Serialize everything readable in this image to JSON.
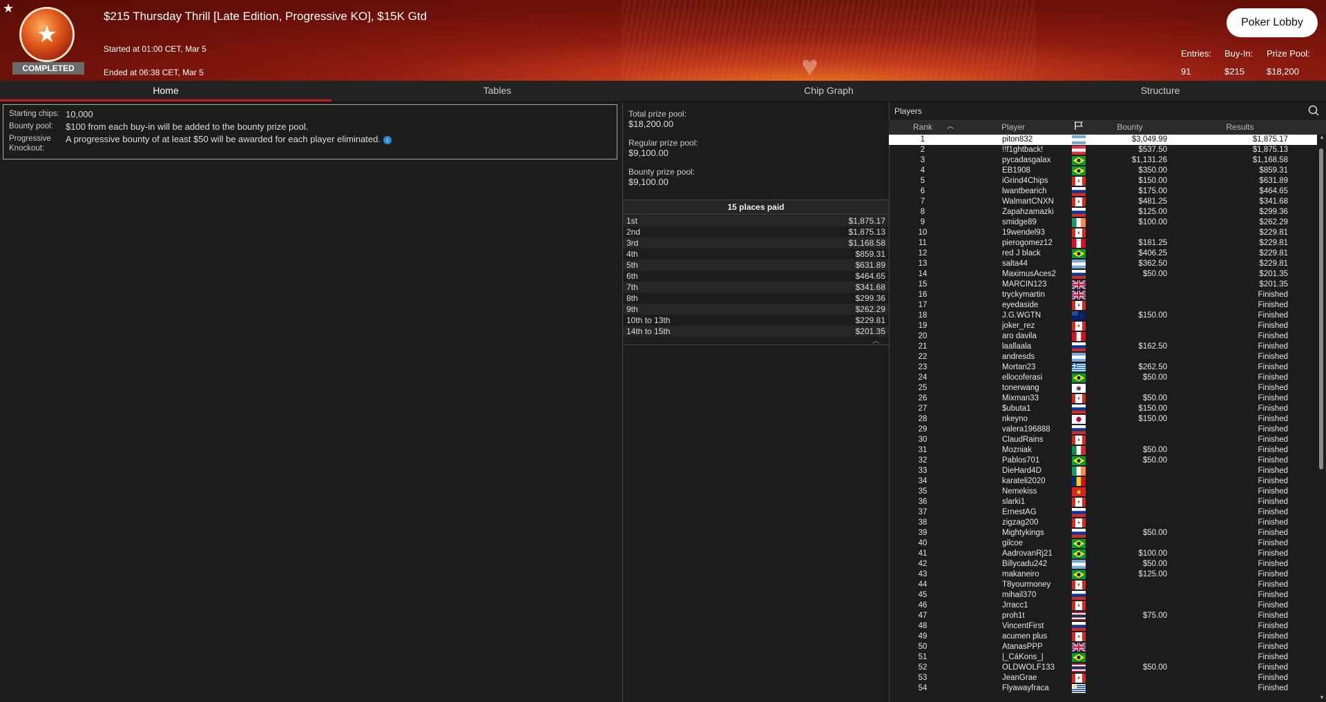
{
  "header": {
    "title": "$215 Thursday Thrill [Late Edition, Progressive KO], $15K Gtd",
    "status": "COMPLETED",
    "started": "Started at 01:00 CET, Mar 5",
    "ended": "Ended at 06:38 CET, Mar 5",
    "lobby_button": "Poker Lobby",
    "entries_label": "Entries:",
    "entries_value": "91",
    "buyin_label": "Buy-In:",
    "buyin_value": "$215",
    "prizepool_label": "Prize Pool:",
    "prizepool_value": "$18,200"
  },
  "tabs": [
    "Home",
    "Tables",
    "Chip Graph",
    "Structure"
  ],
  "info": {
    "starting_chips_label": "Starting chips:",
    "starting_chips_value": "10,000",
    "bounty_pool_label": "Bounty pool:",
    "bounty_pool_value": "$100 from each buy-in will be added to the bounty prize pool.",
    "pko_label": "Progressive Knockout:",
    "pko_value": "A progressive bounty of at least $50 will be awarded for each player eliminated."
  },
  "pools": {
    "total_label": "Total prize pool:",
    "total_value": "$18,200.00",
    "regular_label": "Regular prize pool:",
    "regular_value": "$9,100.00",
    "bounty_label": "Bounty prize pool:",
    "bounty_value": "$9,100.00"
  },
  "places_header": "15 places paid",
  "places": [
    {
      "place": "1st",
      "amount": "$1,875.17"
    },
    {
      "place": "2nd",
      "amount": "$1,875.13"
    },
    {
      "place": "3rd",
      "amount": "$1,168.58"
    },
    {
      "place": "4th",
      "amount": "$859.31"
    },
    {
      "place": "5th",
      "amount": "$631.89"
    },
    {
      "place": "6th",
      "amount": "$464.65"
    },
    {
      "place": "7th",
      "amount": "$341.68"
    },
    {
      "place": "8th",
      "amount": "$299.36"
    },
    {
      "place": "9th",
      "amount": "$262.29"
    },
    {
      "place": "10th to 13th",
      "amount": "$229.81"
    },
    {
      "place": "14th to 15th",
      "amount": "$201.35"
    }
  ],
  "players_title": "Players",
  "columns": {
    "rank": "Rank",
    "player": "Player",
    "bounty": "Bounty",
    "results": "Results"
  },
  "players": [
    {
      "rank": "1",
      "name": "piton832",
      "flag": "ar",
      "bounty": "$3,049.99",
      "result": "$1,875.17"
    },
    {
      "rank": "2",
      "name": "!!f1ghtback!",
      "flag": "at",
      "bounty": "$537.50",
      "result": "$1,875.13"
    },
    {
      "rank": "3",
      "name": "pycadasgalax",
      "flag": "br",
      "bounty": "$1,131.26",
      "result": "$1,168.58"
    },
    {
      "rank": "4",
      "name": "EB1908",
      "flag": "br",
      "bounty": "$350.00",
      "result": "$859.31"
    },
    {
      "rank": "5",
      "name": "iGrind4Chips",
      "flag": "ca",
      "bounty": "$150.00",
      "result": "$631.89"
    },
    {
      "rank": "6",
      "name": "lwantbearich",
      "flag": "ru",
      "bounty": "$175.00",
      "result": "$464.65"
    },
    {
      "rank": "7",
      "name": "WalmartCNXN",
      "flag": "ca",
      "bounty": "$481.25",
      "result": "$341.68"
    },
    {
      "rank": "8",
      "name": "Zapahzamazki",
      "flag": "ru",
      "bounty": "$125.00",
      "result": "$299.36"
    },
    {
      "rank": "9",
      "name": "smidge89",
      "flag": "ie",
      "bounty": "$100.00",
      "result": "$262.29"
    },
    {
      "rank": "10",
      "name": "19wendel93",
      "flag": "ca",
      "bounty": "",
      "result": "$229.81"
    },
    {
      "rank": "11",
      "name": "pierogomez12",
      "flag": "pe",
      "bounty": "$181.25",
      "result": "$229.81"
    },
    {
      "rank": "12",
      "name": "red J black",
      "flag": "br",
      "bounty": "$406.25",
      "result": "$229.81"
    },
    {
      "rank": "13",
      "name": "salta44",
      "flag": "ar",
      "bounty": "$362.50",
      "result": "$229.81"
    },
    {
      "rank": "14",
      "name": "MaximusAces2",
      "flag": "ru",
      "bounty": "$50.00",
      "result": "$201.35"
    },
    {
      "rank": "15",
      "name": "MARCIN123",
      "flag": "gb",
      "bounty": "",
      "result": "$201.35"
    },
    {
      "rank": "16",
      "name": "tryckymartin",
      "flag": "gb",
      "bounty": "",
      "result": "Finished"
    },
    {
      "rank": "17",
      "name": "eyedaside",
      "flag": "ca",
      "bounty": "",
      "result": "Finished"
    },
    {
      "rank": "18",
      "name": "J.G.WGTN",
      "flag": "nz",
      "bounty": "$150.00",
      "result": "Finished"
    },
    {
      "rank": "19",
      "name": "joker_rez",
      "flag": "ca",
      "bounty": "",
      "result": "Finished"
    },
    {
      "rank": "20",
      "name": "aro davila",
      "flag": "pe",
      "bounty": "",
      "result": "Finished"
    },
    {
      "rank": "21",
      "name": "laallaala",
      "flag": "ru",
      "bounty": "$162.50",
      "result": "Finished"
    },
    {
      "rank": "22",
      "name": "andresds",
      "flag": "ar",
      "bounty": "",
      "result": "Finished"
    },
    {
      "rank": "23",
      "name": "Mortan23",
      "flag": "gr",
      "bounty": "$262.50",
      "result": "Finished"
    },
    {
      "rank": "24",
      "name": "ellocoferasi",
      "flag": "br",
      "bounty": "$50.00",
      "result": "Finished"
    },
    {
      "rank": "25",
      "name": "tonerwang",
      "flag": "kr",
      "bounty": "",
      "result": "Finished"
    },
    {
      "rank": "26",
      "name": "Mixman33",
      "flag": "ca",
      "bounty": "$50.00",
      "result": "Finished"
    },
    {
      "rank": "27",
      "name": "$ubuta1",
      "flag": "ru",
      "bounty": "$150.00",
      "result": "Finished"
    },
    {
      "rank": "28",
      "name": "nkeyno",
      "flag": "jp",
      "bounty": "$150.00",
      "result": "Finished"
    },
    {
      "rank": "29",
      "name": "valera196888",
      "flag": "ru",
      "bounty": "",
      "result": "Finished"
    },
    {
      "rank": "30",
      "name": "ClaudRains",
      "flag": "ca",
      "bounty": "",
      "result": "Finished"
    },
    {
      "rank": "31",
      "name": "Mozniak",
      "flag": "it",
      "bounty": "$50.00",
      "result": "Finished"
    },
    {
      "rank": "32",
      "name": "Pablos701",
      "flag": "br",
      "bounty": "$50.00",
      "result": "Finished"
    },
    {
      "rank": "33",
      "name": "DieHard4D",
      "flag": "ie",
      "bounty": "",
      "result": "Finished"
    },
    {
      "rank": "34",
      "name": "karateli2020",
      "flag": "ro",
      "bounty": "",
      "result": "Finished"
    },
    {
      "rank": "35",
      "name": "Nemekiss",
      "flag": "vn",
      "bounty": "",
      "result": "Finished"
    },
    {
      "rank": "36",
      "name": "slarki1",
      "flag": "ca",
      "bounty": "",
      "result": "Finished"
    },
    {
      "rank": "37",
      "name": "ErnestAG",
      "flag": "ru",
      "bounty": "",
      "result": "Finished"
    },
    {
      "rank": "38",
      "name": "zigzag200",
      "flag": "ca",
      "bounty": "",
      "result": "Finished"
    },
    {
      "rank": "39",
      "name": "Mightykings",
      "flag": "ru",
      "bounty": "$50.00",
      "result": "Finished"
    },
    {
      "rank": "40",
      "name": "gilcoe",
      "flag": "br",
      "bounty": "",
      "result": "Finished"
    },
    {
      "rank": "41",
      "name": "AadrovanRj21",
      "flag": "br",
      "bounty": "$100.00",
      "result": "Finished"
    },
    {
      "rank": "42",
      "name": "Billycadu242",
      "flag": "ar",
      "bounty": "$50.00",
      "result": "Finished"
    },
    {
      "rank": "43",
      "name": "makaneiro",
      "flag": "br",
      "bounty": "$125.00",
      "result": "Finished"
    },
    {
      "rank": "44",
      "name": "T8yourmoney",
      "flag": "ca",
      "bounty": "",
      "result": "Finished"
    },
    {
      "rank": "45",
      "name": "mihail370",
      "flag": "ru",
      "bounty": "",
      "result": "Finished"
    },
    {
      "rank": "46",
      "name": "Jrracc1",
      "flag": "ca",
      "bounty": "",
      "result": "Finished"
    },
    {
      "rank": "47",
      "name": "proh1t",
      "flag": "th",
      "bounty": "$75.00",
      "result": "Finished"
    },
    {
      "rank": "48",
      "name": "VincentFirst",
      "flag": "ru",
      "bounty": "",
      "result": "Finished"
    },
    {
      "rank": "49",
      "name": "acumen plus",
      "flag": "ca",
      "bounty": "",
      "result": "Finished"
    },
    {
      "rank": "50",
      "name": "AtanasPPP",
      "flag": "gb",
      "bounty": "",
      "result": "Finished"
    },
    {
      "rank": "51",
      "name": "|_CáKons_|",
      "flag": "br",
      "bounty": "",
      "result": "Finished"
    },
    {
      "rank": "52",
      "name": "OLDWOLF133",
      "flag": "th",
      "bounty": "$50.00",
      "result": "Finished"
    },
    {
      "rank": "53",
      "name": "JeanGrae",
      "flag": "ca",
      "bounty": "",
      "result": "Finished"
    },
    {
      "rank": "54",
      "name": "Flyawayfraca",
      "flag": "uy",
      "bounty": "",
      "result": "Finished"
    }
  ],
  "colors": {
    "accent": "#c81e1e",
    "header_dark": "#5a0c06",
    "panel_bg": "#1c1c1c"
  }
}
